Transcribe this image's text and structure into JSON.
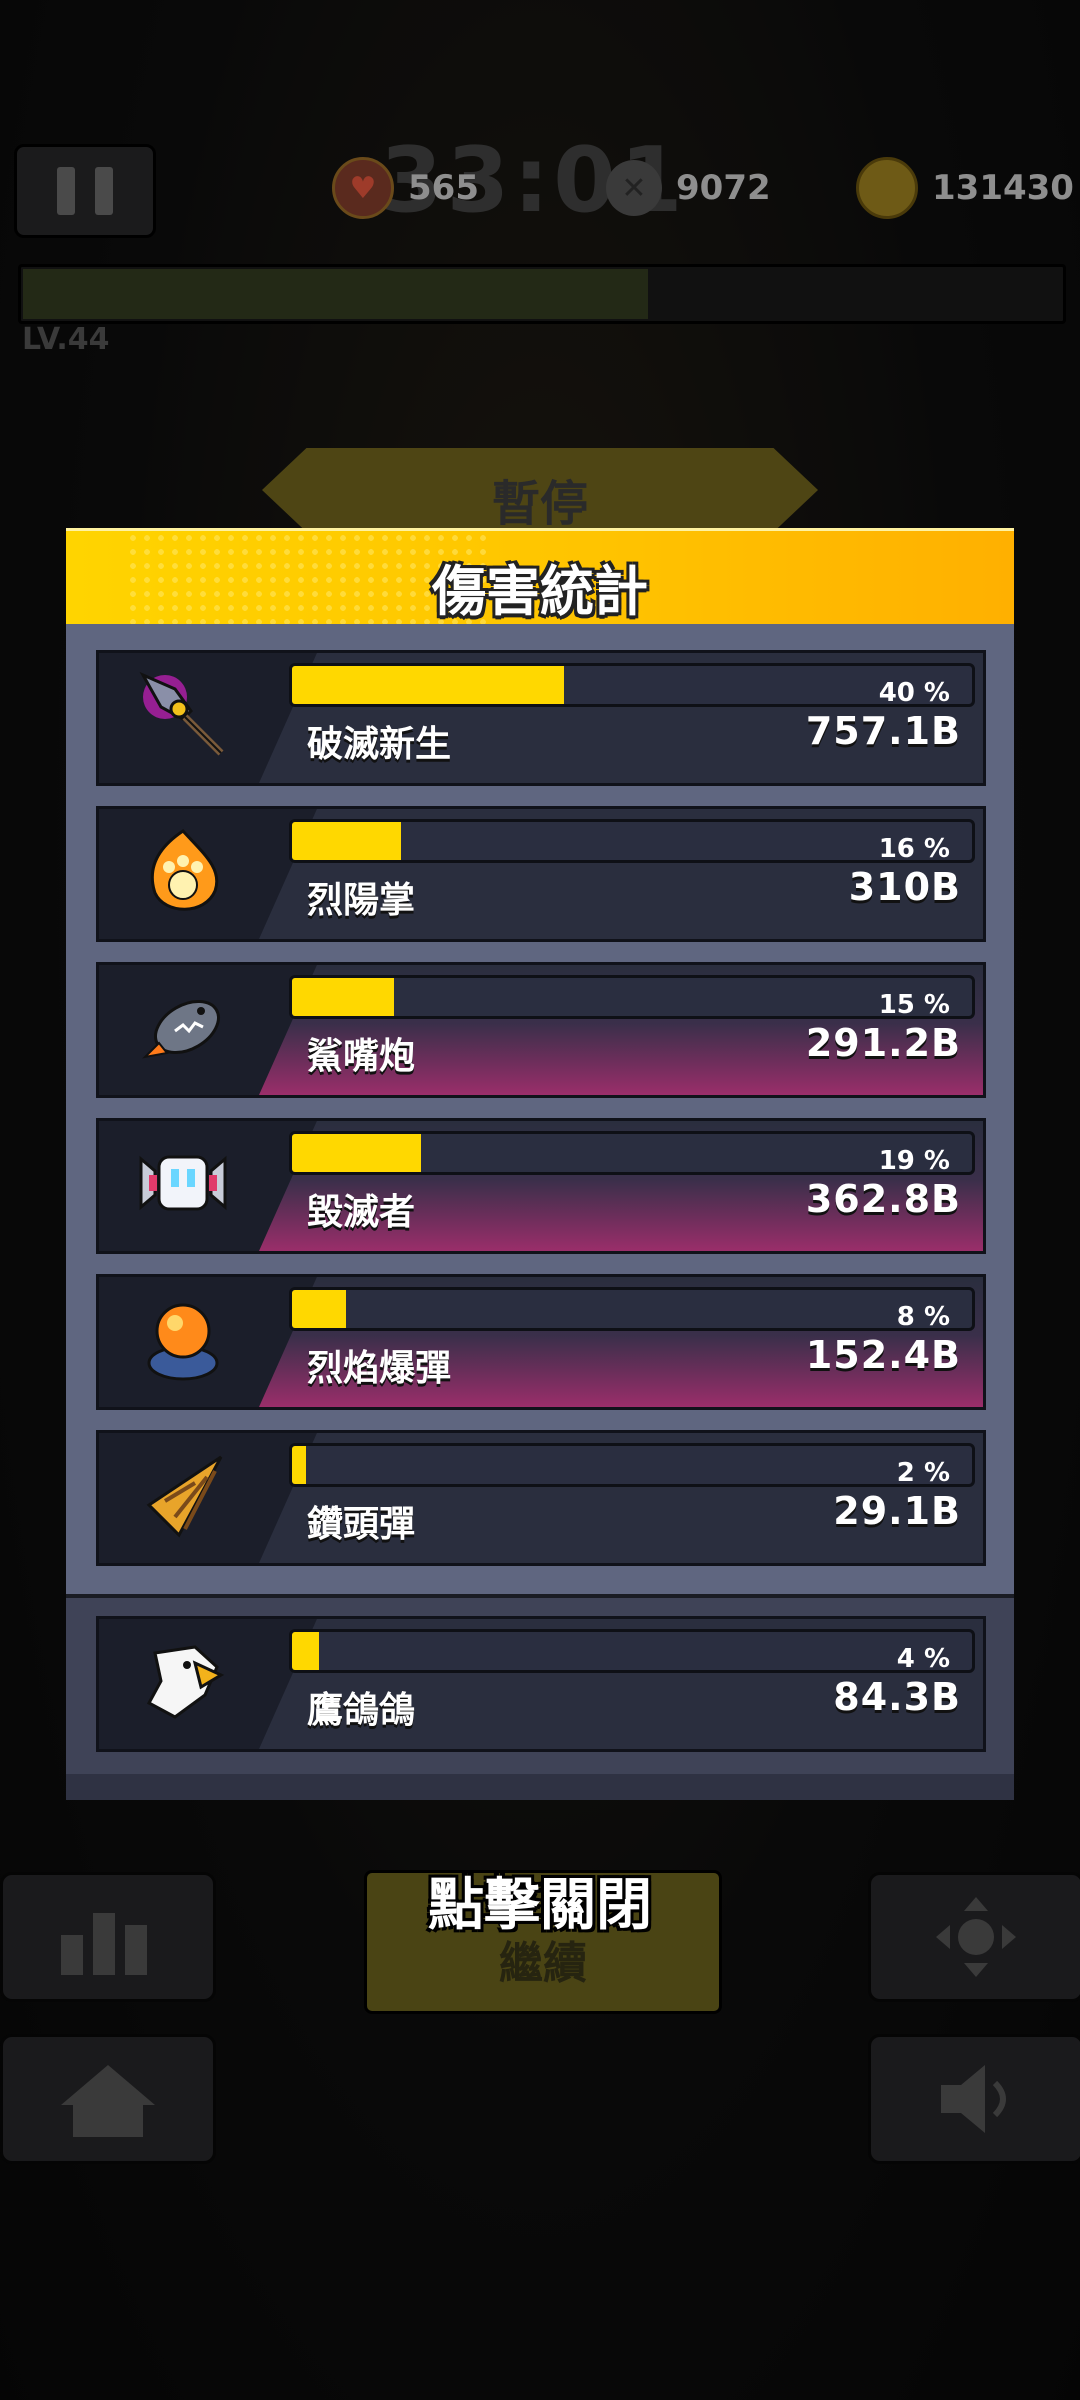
{
  "hud": {
    "timer": "33:01",
    "hearts": "565",
    "kills": "9072",
    "coins": "131430",
    "level": "LV.44",
    "xp_fraction": 0.6
  },
  "pause_title": "暫停",
  "panel": {
    "title": "傷害統計",
    "rows": [
      {
        "name": "破滅新生",
        "percent_label": "40 %",
        "percent": 40,
        "value": "757.1B",
        "icon": "doom-sword-icon",
        "highlight": false
      },
      {
        "name": "烈陽掌",
        "percent_label": "16 %",
        "percent": 16,
        "value": "310B",
        "icon": "flame-paw-icon",
        "highlight": false
      },
      {
        "name": "鯊嘴炮",
        "percent_label": "15 %",
        "percent": 15,
        "value": "291.2B",
        "icon": "shark-cannon-icon",
        "highlight": true
      },
      {
        "name": "毀滅者",
        "percent_label": "19 %",
        "percent": 19,
        "value": "362.8B",
        "icon": "destroyer-robot-icon",
        "highlight": true
      },
      {
        "name": "烈焰爆彈",
        "percent_label": "8 %",
        "percent": 8,
        "value": "152.4B",
        "icon": "flame-bomb-icon",
        "highlight": true
      },
      {
        "name": "鑽頭彈",
        "percent_label": "2 %",
        "percent": 2,
        "value": "29.1B",
        "icon": "drill-shell-icon",
        "highlight": false
      }
    ],
    "pet_row": {
      "name": "鷹鴿鴿",
      "percent_label": "4 %",
      "percent": 4,
      "value": "84.3B",
      "icon": "eagle-pet-icon",
      "highlight": false
    }
  },
  "close_hint": "點擊關閉",
  "continue_label": "繼續",
  "colors": {
    "bar_fill": "#ffd800",
    "header": "#ffc400",
    "panel": "#5f6680"
  }
}
